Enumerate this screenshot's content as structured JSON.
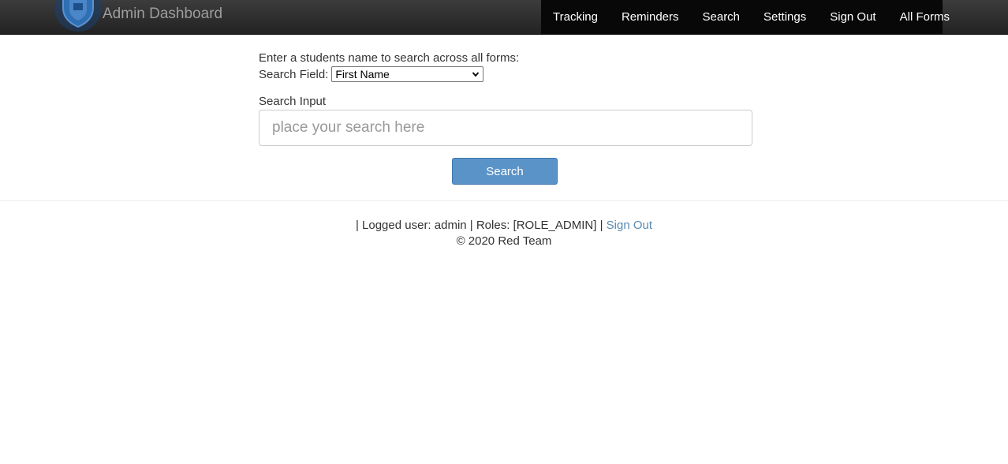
{
  "navbar": {
    "brand_title": "Admin Dashboard",
    "menu": [
      "Tracking",
      "Reminders",
      "Search",
      "Settings",
      "Sign Out",
      "All Forms"
    ],
    "colors": {
      "bar": "#222222",
      "menu_bg": "#080808",
      "link": "#ffffff"
    }
  },
  "search": {
    "intro_text": "Enter a students name to search across all forms:",
    "field_label": "Search Field:",
    "field_selected": "First Name",
    "input_label": "Search Input",
    "input_placeholder": "place your search here",
    "input_value": "",
    "button_label": "Search",
    "button_color": "#5a93c8"
  },
  "footer": {
    "session_prefix": "| Logged user: admin | Roles: [ROLE_ADMIN] |",
    "sign_out_link": "Sign Out",
    "copyright": "© 2020 Red Team"
  }
}
